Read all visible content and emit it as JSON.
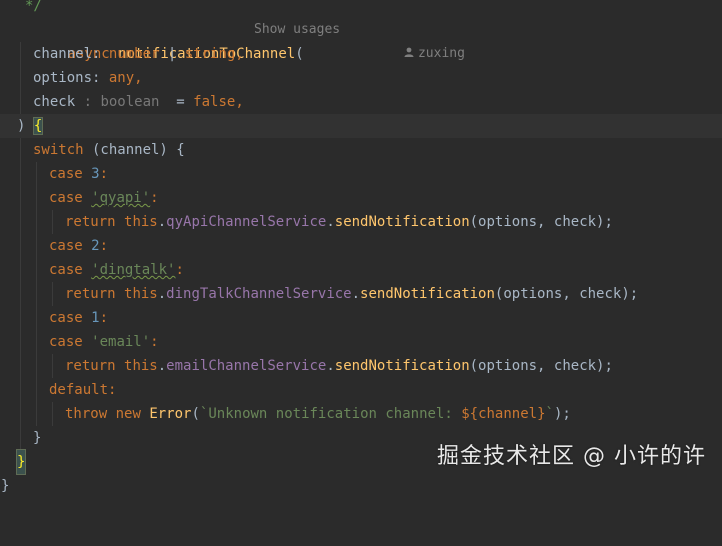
{
  "editor": {
    "theme_colors": {
      "background": "#2b2b2b",
      "keyword": "#cc7832",
      "function": "#ffc66d",
      "string": "#6a8759",
      "number": "#6897bb",
      "property": "#9876aa",
      "default": "#a9b7c6"
    },
    "lines": {
      "l0": {
        "comment": "*/"
      },
      "l1": {
        "async": "async",
        "fn_name": "notificationToChannel",
        "paren": "(",
        "inlay_usages": "Show usages",
        "inlay_author": "zuxing"
      },
      "l2": {
        "name": "channel",
        "colon": ": ",
        "type1": "number",
        "pipe": " | ",
        "type2": "string",
        "comma": ","
      },
      "l3": {
        "name": "options",
        "colon": ": ",
        "type": "any",
        "comma": ","
      },
      "l4": {
        "name": "check",
        "hint": " : boolean ",
        "eq": " = ",
        "val": "false",
        "comma": ","
      },
      "l5": {
        "close": ") ",
        "brace": "{"
      },
      "l6": {
        "kw": "switch",
        "rest": " (channel) {"
      },
      "l7": {
        "kw": "case",
        "num": "3",
        "colon": ":"
      },
      "l8": {
        "kw": "case",
        "str": "'qyapi'",
        "colon": ":"
      },
      "l9": {
        "ret": "return",
        "this": "this",
        "dot1": ".",
        "svc": "qyApiChannelService",
        "dot2": ".",
        "method": "sendNotification",
        "args": "(options, check);"
      },
      "l10": {
        "kw": "case",
        "num": "2",
        "colon": ":"
      },
      "l11": {
        "kw": "case",
        "str": "'dingtalk'",
        "colon": ":"
      },
      "l12": {
        "ret": "return",
        "this": "this",
        "dot1": ".",
        "svc": "dingTalkChannelService",
        "dot2": ".",
        "method": "sendNotification",
        "args": "(options, check);"
      },
      "l13": {
        "kw": "case",
        "num": "1",
        "colon": ":"
      },
      "l14": {
        "kw": "case",
        "str": "'email'",
        "colon": ":"
      },
      "l15": {
        "ret": "return",
        "this": "this",
        "dot1": ".",
        "svc": "emailChannelService",
        "dot2": ".",
        "method": "sendNotification",
        "args": "(options, check);"
      },
      "l16": {
        "kw": "default",
        "colon": ":"
      },
      "l17": {
        "throw": "throw",
        "new": "new",
        "cls": "Error",
        "paren": "(",
        "str": "`Unknown notification channel: ",
        "interp": "${channel}",
        "strend": "`",
        "end": ");"
      },
      "l18": {
        "brace": "}"
      },
      "l19": {
        "brace": "}"
      },
      "l20": {
        "brace": "}"
      }
    }
  },
  "watermark": {
    "text": "掘金技术社区 @ 小许的许"
  }
}
